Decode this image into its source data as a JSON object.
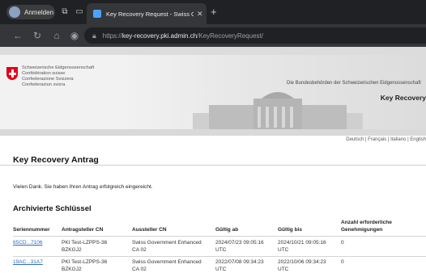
{
  "browser": {
    "profile_label": "Anmelden",
    "tab_title": "Key Recovery Request - Swiss Go",
    "url_host": "key-recovery.pki.admin.ch",
    "url_prefix": "https://",
    "url_path": "/KeyRecoveryRequest/"
  },
  "header": {
    "gov_lines": [
      "Schweizerische Eidgenossenschaft",
      "Confédération suisse",
      "Confederazione Svizzera",
      "Confederaziun svizra"
    ],
    "authorities": "Die Bundesbehörden der Schweizerischen Eidgenossenschaft",
    "app_title": "Key Recovery",
    "languages": "Deutsch | Français | Italiano | English"
  },
  "main": {
    "page_title": "Key Recovery Antrag",
    "message": "Vielen Dank. Sie haben Ihren Antrag erfolgreich eingereicht.",
    "section_title": "Archivierte Schlüssel",
    "columns": [
      "Seriennummer",
      "Antragsteller CN",
      "Aussteller CN",
      "Gültig ab",
      "Gültig bis",
      "Anzahl erforderliche Genehmigungen"
    ],
    "rows": [
      {
        "serial": "65CD...7106",
        "applicant": [
          "PKI Test-LZPPS-36",
          "BZKGJ2"
        ],
        "issuer": [
          "Swiss Government Enhanced",
          "CA 02"
        ],
        "valid_from": [
          "2024/07/23 09:05:16",
          "UTC"
        ],
        "valid_to": [
          "2024/10/21 09:05:16",
          "UTC"
        ],
        "approvals": "0"
      },
      {
        "serial": "19AC...31A7",
        "applicant": [
          "PKI Test-LZPPS-36",
          "BZKGJ2"
        ],
        "issuer": [
          "Swiss Government Enhanced",
          "CA 02"
        ],
        "valid_from": [
          "2022/07/08 09:34:23",
          "UTC"
        ],
        "valid_to": [
          "2022/10/06 09:34:23",
          "UTC"
        ],
        "approvals": "0"
      }
    ]
  },
  "icons": {
    "back": "arrow-left",
    "forward": "arrow-right",
    "reload": "reload",
    "home": "home",
    "site_info": "lock"
  },
  "colors": {
    "link": "#2a6ebb",
    "crest_red": "#e2001a",
    "chrome_dark": "#202124"
  }
}
